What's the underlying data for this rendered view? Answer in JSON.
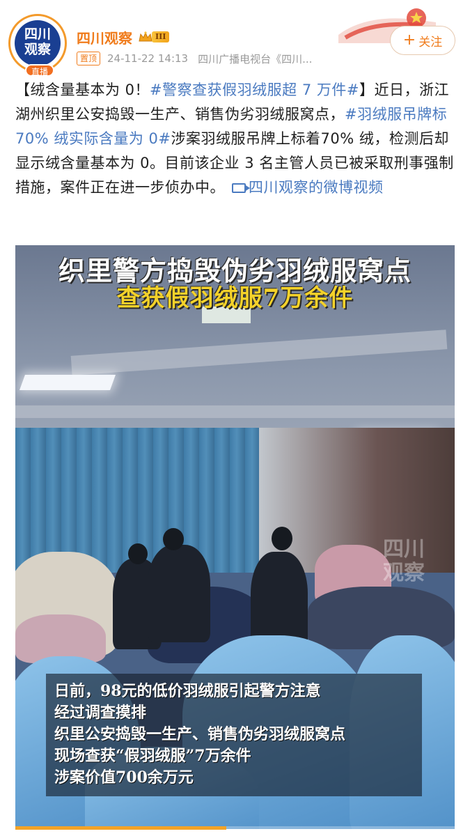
{
  "author": {
    "name": "四川观察",
    "avatar_text": "四川观察",
    "live_label": "直播",
    "vip_level": "III"
  },
  "meta": {
    "pinned": "置顶",
    "time": "24-11-22 14:13",
    "source": "四川广播电视台《四川..."
  },
  "follow_label": "关注",
  "post": {
    "seg1": "【绒含量基本为 0！",
    "tag1": "#警察查获假羽绒服超 7 万件#",
    "seg2": "】近日，浙江湖州织里公安捣毁一生产、销售伪劣羽绒服窝点，",
    "tag2": "#羽绒服吊牌标 70% 绒实际含量为 0#",
    "seg3": "涉案羽绒服吊牌上标着70% 绒，检测后却显示绒含量基本为 0。目前该企业 3 名主管人员已被采取刑事强制措施，案件正在进一步侦办中。",
    "video_link": "四川观察的微博视频"
  },
  "video": {
    "title_line1": "织里警方捣毁伪劣羽绒服窝点",
    "title_line2": "查获假羽绒服7万余件",
    "watermark": "四川观察",
    "caption": [
      "日前，98元的低价羽绒服引起警方注意",
      "经过调查摸排",
      "织里公安捣毁一生产、销售伪劣羽绒服窝点",
      "现场查获“假羽绒服”7万余件",
      "涉案价值700余万元"
    ],
    "progress": 0.48
  },
  "colors": {
    "author_orange": "#f07c1c",
    "link_blue": "#4a7ac0",
    "avatar_blue": "#1a3f92",
    "title_yellow": "#f4d22a"
  },
  "icons": {
    "vip": "crown-icon",
    "follow": "plus-icon",
    "video_link": "video-icon"
  }
}
